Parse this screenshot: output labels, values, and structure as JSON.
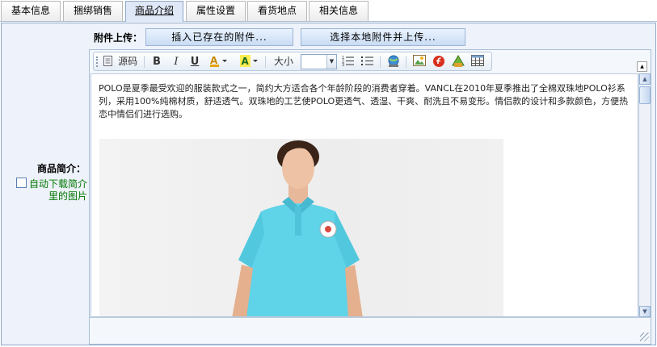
{
  "tabs": [
    {
      "label": "基本信息",
      "active": false
    },
    {
      "label": "捆绑销售",
      "active": false
    },
    {
      "label": "商品介绍",
      "active": true
    },
    {
      "label": "属性设置",
      "active": false
    },
    {
      "label": "看货地点",
      "active": false
    },
    {
      "label": "相关信息",
      "active": false
    }
  ],
  "upload": {
    "label": "附件上传：",
    "insert_existing": "插入已存在的附件...",
    "select_local": "选择本地附件并上传..."
  },
  "toolbar": {
    "source_label": "源码",
    "bold": "B",
    "italic": "I",
    "underline": "U",
    "size_label": "大小",
    "size_value": ""
  },
  "content": {
    "paragraph": "POLO是夏季最受欢迎的服装款式之一，简约大方适合各个年龄阶段的消费者穿着。VANCL在2010年夏季推出了全棉双珠地POLO衫系列，采用100%纯棉材质，舒适透气。双珠地的工艺使POLO更透气、透湿、干爽、耐洗且不易变形。情侣款的设计和多款颜色，方便热恋中情侣们进行选购。"
  },
  "field": {
    "label": "商品简介：",
    "auto_download": "自动下载简介里的图片"
  },
  "colors": {
    "frame_bg": "#eef2fa",
    "shirt": "#5fd3e8"
  }
}
